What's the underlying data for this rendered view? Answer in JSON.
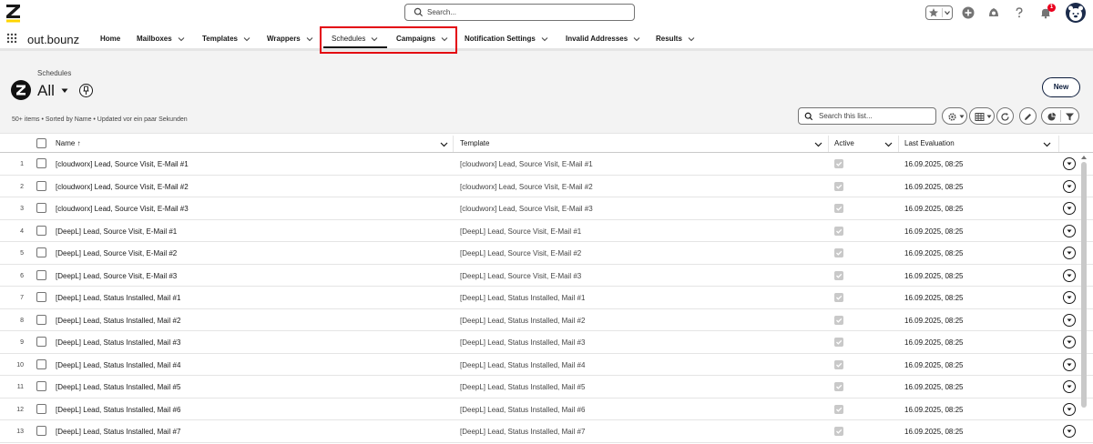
{
  "header": {
    "search_placeholder": "Search...",
    "notification_count": "1"
  },
  "nav": {
    "app_name": "out.bounz",
    "items": [
      {
        "label": "Home",
        "has_menu": false
      },
      {
        "label": "Mailboxes",
        "has_menu": true
      },
      {
        "label": "Templates",
        "has_menu": true
      },
      {
        "label": "Wrappers",
        "has_menu": true
      },
      {
        "label": "Schedules",
        "has_menu": true,
        "active": true
      },
      {
        "label": "Campaigns",
        "has_menu": true
      },
      {
        "label": "Notification Settings",
        "has_menu": true
      },
      {
        "label": "Invalid Addresses",
        "has_menu": true
      },
      {
        "label": "Results",
        "has_menu": true
      }
    ]
  },
  "list_header": {
    "object_label": "Schedules",
    "view_name": "All",
    "new_button": "New",
    "meta": "50+ items • Sorted by Name • Updated vor ein paar Sekunden",
    "search_placeholder": "Search this list..."
  },
  "table": {
    "columns": {
      "name": "Name",
      "sort_indicator": "↑",
      "template": "Template",
      "active": "Active",
      "last_evaluation": "Last Evaluation"
    },
    "rows": [
      {
        "num": "1",
        "name": "[cloudworx] Lead, Source Visit, E-Mail #1",
        "template": "[cloudworx] Lead, Source Visit, E-Mail #1",
        "active": true,
        "last_evaluation": "16.09.2025, 08:25"
      },
      {
        "num": "2",
        "name": "[cloudworx] Lead, Source Visit, E-Mail #2",
        "template": "[cloudworx] Lead, Source Visit, E-Mail #2",
        "active": true,
        "last_evaluation": "16.09.2025, 08:25"
      },
      {
        "num": "3",
        "name": "[cloudworx] Lead, Source Visit, E-Mail #3",
        "template": "[cloudworx] Lead, Source Visit, E-Mail #3",
        "active": true,
        "last_evaluation": "16.09.2025, 08:25"
      },
      {
        "num": "4",
        "name": "[DeepL] Lead, Source Visit, E-Mail #1",
        "template": "[DeepL] Lead, Source Visit, E-Mail #1",
        "active": true,
        "last_evaluation": "16.09.2025, 08:25"
      },
      {
        "num": "5",
        "name": "[DeepL] Lead, Source Visit, E-Mail #2",
        "template": "[DeepL] Lead, Source Visit, E-Mail #2",
        "active": true,
        "last_evaluation": "16.09.2025, 08:25"
      },
      {
        "num": "6",
        "name": "[DeepL] Lead, Source Visit, E-Mail #3",
        "template": "[DeepL] Lead, Source Visit, E-Mail #3",
        "active": true,
        "last_evaluation": "16.09.2025, 08:25"
      },
      {
        "num": "7",
        "name": "[DeepL] Lead, Status Installed, Mail #1",
        "template": "[DeepL] Lead, Status Installed, Mail #1",
        "active": true,
        "last_evaluation": "16.09.2025, 08:25"
      },
      {
        "num": "8",
        "name": "[DeepL] Lead, Status Installed, Mail #2",
        "template": "[DeepL] Lead, Status Installed, Mail #2",
        "active": true,
        "last_evaluation": "16.09.2025, 08:25"
      },
      {
        "num": "9",
        "name": "[DeepL] Lead, Status Installed, Mail #3",
        "template": "[DeepL] Lead, Status Installed, Mail #3",
        "active": true,
        "last_evaluation": "16.09.2025, 08:25"
      },
      {
        "num": "10",
        "name": "[DeepL] Lead, Status Installed, Mail #4",
        "template": "[DeepL] Lead, Status Installed, Mail #4",
        "active": true,
        "last_evaluation": "16.09.2025, 08:25"
      },
      {
        "num": "11",
        "name": "[DeepL] Lead, Status Installed, Mail #5",
        "template": "[DeepL] Lead, Status Installed, Mail #5",
        "active": true,
        "last_evaluation": "16.09.2025, 08:25"
      },
      {
        "num": "12",
        "name": "[DeepL] Lead, Status Installed, Mail #6",
        "template": "[DeepL] Lead, Status Installed, Mail #6",
        "active": true,
        "last_evaluation": "16.09.2025, 08:25"
      },
      {
        "num": "13",
        "name": "[DeepL] Lead, Status Installed, Mail #7",
        "template": "[DeepL] Lead, Status Installed, Mail #7",
        "active": true,
        "last_evaluation": "16.09.2025, 08:25"
      }
    ]
  },
  "colors": {
    "highlight": "#e3000f",
    "brand_yellow": "#ffd500",
    "navy": "#0b1b3b",
    "badge": "#ea001e"
  },
  "icons": [
    "z-logo-icon",
    "search-icon",
    "star-icon",
    "add-icon",
    "trailhead-icon",
    "help-icon",
    "bell-icon",
    "avatar",
    "app-launcher-icon",
    "pin-icon",
    "settings-icon",
    "table-view-icon",
    "refresh-icon",
    "edit-icon",
    "chart-icon",
    "filter-icon",
    "chevron-down-icon",
    "row-action-icon"
  ]
}
